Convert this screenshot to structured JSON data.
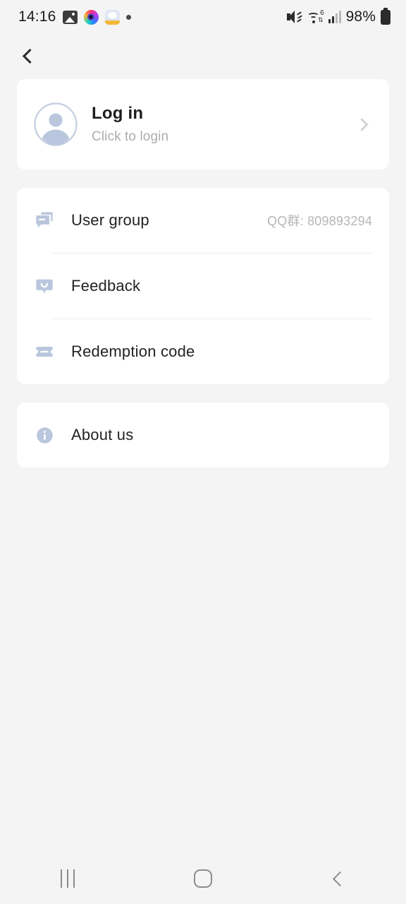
{
  "status_bar": {
    "time": "14:16",
    "battery_percent": "98%",
    "left_icons": [
      "photo-icon",
      "camera-ring-icon",
      "app-badge-icon",
      "dot-icon"
    ],
    "right_icons": [
      "volume-mute-icon",
      "wifi-6-icon",
      "signal-bars-icon",
      "battery-icon"
    ],
    "wifi_generation": "6",
    "wifi_arrows": "⇅"
  },
  "header": {
    "back_icon": "chevron-left-icon"
  },
  "login_card": {
    "title": "Log in",
    "subtitle": "Click to login",
    "avatar_icon": "account-circle-icon",
    "chevron_icon": "chevron-right-icon"
  },
  "menu_card": {
    "items": [
      {
        "label": "User group",
        "value": "QQ群: 809893294",
        "icon": "forum-icon",
        "name": "user-group"
      },
      {
        "label": "Feedback",
        "value": "",
        "icon": "feedback-icon",
        "name": "feedback"
      },
      {
        "label": "Redemption code",
        "value": "",
        "icon": "ticket-icon",
        "name": "redemption-code"
      }
    ]
  },
  "about_card": {
    "items": [
      {
        "label": "About us",
        "value": "",
        "icon": "info-circle-icon",
        "name": "about-us"
      }
    ]
  },
  "nav_bar": {
    "recents_label": "recents-icon",
    "home_label": "home-icon",
    "back_label": "back-icon"
  },
  "colors": {
    "background": "#f4f4f4",
    "card": "#ffffff",
    "icon_blue_gray": "#b9c6dd",
    "text_primary": "#232323",
    "text_muted": "#b6b6b6"
  }
}
